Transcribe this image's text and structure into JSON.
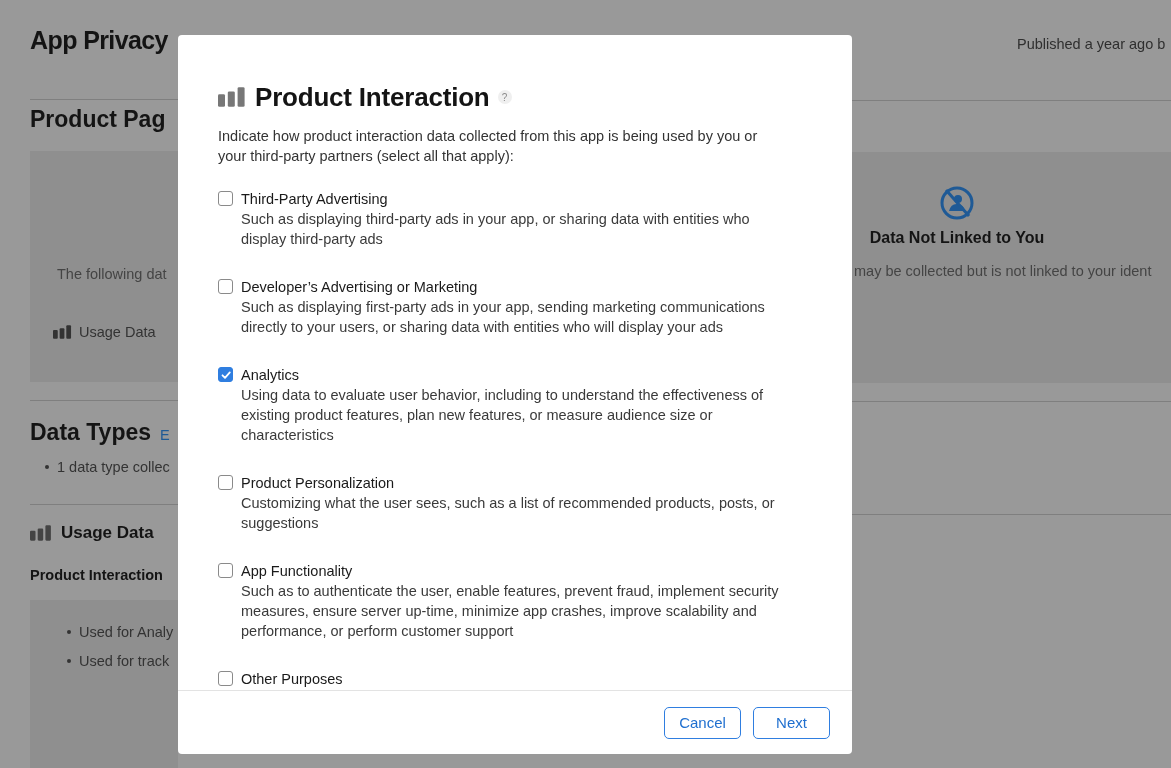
{
  "background": {
    "title": "App Privacy",
    "published": "Published a year ago b",
    "product_page": {
      "heading": "Product Pag",
      "left_text": "The following dat",
      "left_item": "Usage Data",
      "right_title": "Data Not Linked to You",
      "right_text": "may be collected but is not linked to your ident"
    },
    "data_types": {
      "heading": "Data Types",
      "link": "E",
      "bullet": "1 data type collec"
    },
    "usage": {
      "heading": "Usage Data",
      "subheading": "Product Interaction",
      "uses": [
        "Used for Analy",
        "Used for track"
      ]
    }
  },
  "dialog": {
    "title": "Product Interaction",
    "help": "?",
    "description": "Indicate how product interaction data collected from this app is being used by you or your third-party partners (select all that apply):",
    "options": [
      {
        "label": "Third-Party Advertising",
        "description": "Such as displaying third-party ads in your app, or sharing data with entities who display third-party ads",
        "checked": false
      },
      {
        "label": "Developer’s Advertising or Marketing",
        "description": "Such as displaying first-party ads in your app, sending marketing communications directly to your users, or sharing data with entities who will display your ads",
        "checked": false
      },
      {
        "label": "Analytics",
        "description": "Using data to evaluate user behavior, including to understand the effectiveness of existing product features, plan new features, or measure audience size or characteristics",
        "checked": true
      },
      {
        "label": "Product Personalization",
        "description": "Customizing what the user sees, such as a list of recommended products, posts, or suggestions",
        "checked": false
      },
      {
        "label": "App Functionality",
        "description": "Such as to authenticate the user, enable features, prevent fraud, implement security measures, ensure server up-time, minimize app crashes, improve scalability and performance, or perform customer support",
        "checked": false
      },
      {
        "label": "Other Purposes",
        "checked": false
      }
    ],
    "buttons": [
      "Cancel",
      "Next"
    ]
  }
}
